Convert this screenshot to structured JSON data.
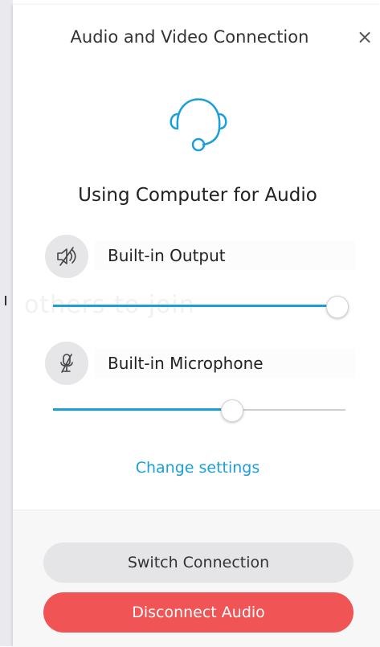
{
  "dialog": {
    "title": "Audio and Video Connection",
    "close_glyph": "×"
  },
  "status": {
    "title": "Using Computer for Audio",
    "icon": "headset-icon",
    "background_text": "others to join"
  },
  "output": {
    "device": "Built-in Output",
    "icon": "speaker-muted-icon",
    "volume_percent": 97
  },
  "input": {
    "device": "Built-in Microphone",
    "icon": "microphone-muted-icon",
    "volume_percent": 61
  },
  "links": {
    "change_settings": "Change settings"
  },
  "actions": {
    "switch_label": "Switch Connection",
    "disconnect_label": "Disconnect Audio"
  },
  "colors": {
    "accent": "#1a9fd9",
    "danger": "#f05454"
  }
}
